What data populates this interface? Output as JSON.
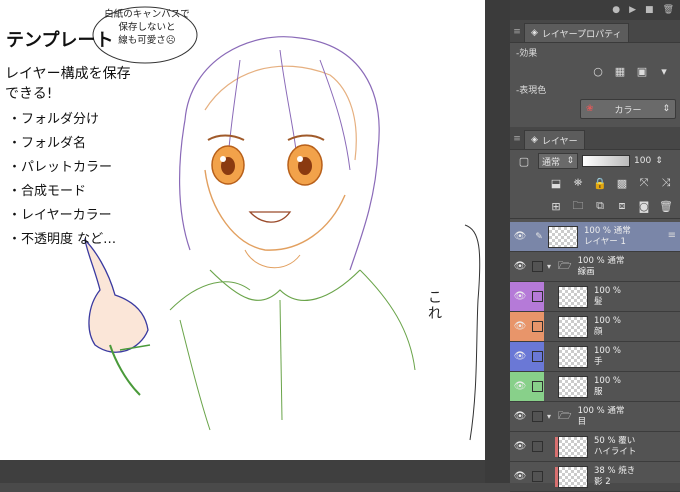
{
  "canvas": {
    "title": "テンプレート",
    "note_lines": [
      "白紙のキャンバスで",
      "保存しないと",
      "線も可愛さ☹"
    ],
    "heading_lines": [
      "レイヤー構成を保存",
      "できる!"
    ],
    "bullets": [
      "・フォルダ分け",
      "・フォルダ名",
      "・パレットカラー",
      "・合成モード",
      "・レイヤーカラー",
      "・不透明度 など…"
    ],
    "side_note": "これ"
  },
  "layer_property": {
    "tab": "レイヤープロパティ",
    "effect_label": "-効果",
    "expression_label": "-表現色",
    "expression_value": "カラー"
  },
  "layer_panel": {
    "tab": "レイヤー",
    "blend_mode": "通常",
    "opacity": "100",
    "layers": [
      {
        "line1": "100 % 通常",
        "line2": "レイヤー 1",
        "type": "raster",
        "indent": 0,
        "color": "",
        "selected": true
      },
      {
        "line1": "100 % 通常",
        "line2": "線画",
        "type": "folder",
        "indent": 0,
        "color": "",
        "selected": false
      },
      {
        "line1": "100 %",
        "line2": "髪",
        "type": "raster",
        "indent": 1,
        "color": "#b57ad8",
        "selected": false
      },
      {
        "line1": "100 %",
        "line2": "顔",
        "type": "raster",
        "indent": 1,
        "color": "#e8956a",
        "selected": false
      },
      {
        "line1": "100 %",
        "line2": "手",
        "type": "raster",
        "indent": 1,
        "color": "#6a78d6",
        "selected": false
      },
      {
        "line1": "100 %",
        "line2": "服",
        "type": "raster",
        "indent": 1,
        "color": "#88d08a",
        "selected": false
      },
      {
        "line1": "100 % 通常",
        "line2": "目",
        "type": "folder",
        "indent": 0,
        "color": "",
        "selected": false
      },
      {
        "line1": "50 % 覆い",
        "line2": "ハイライト",
        "type": "raster",
        "indent": 1,
        "color": "",
        "selected": false
      },
      {
        "line1": "38 % 焼き",
        "line2": "影 2",
        "type": "raster",
        "indent": 1,
        "color": "",
        "selected": false
      }
    ]
  },
  "colors": {
    "panel_bg": "#535353",
    "selected_layer": "#7a86a8"
  }
}
